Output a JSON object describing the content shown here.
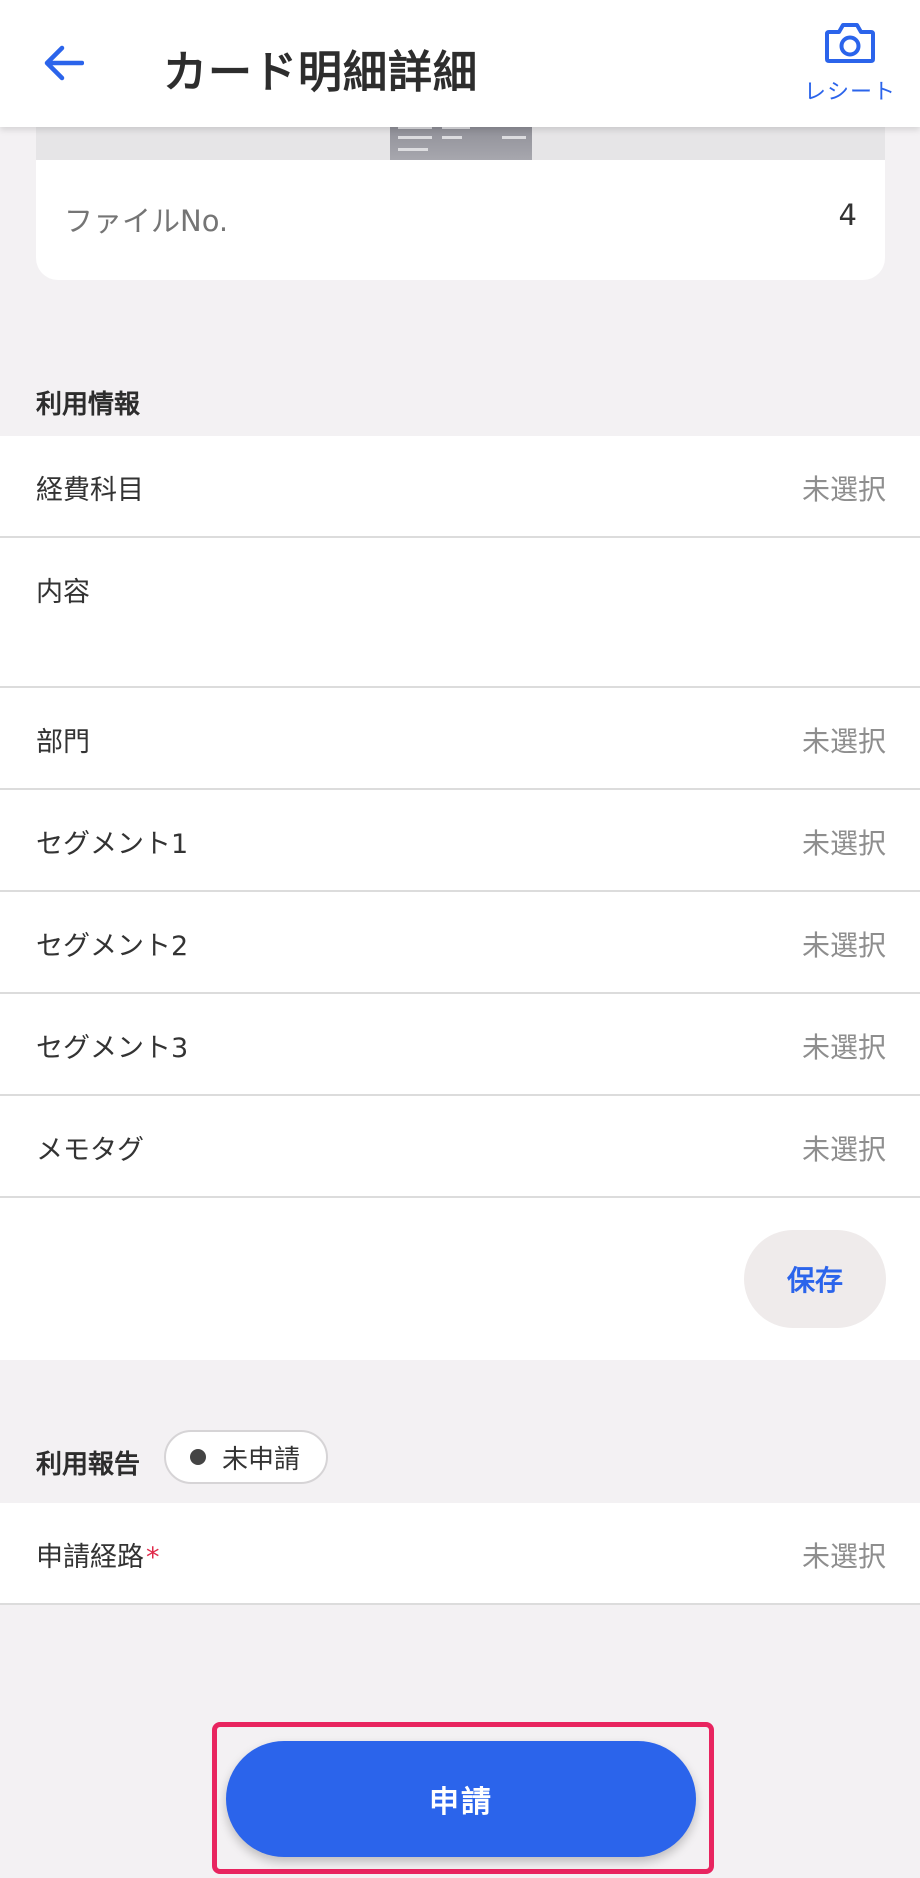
{
  "header": {
    "title": "カード明細詳細",
    "receipt_label": "レシート",
    "back_icon": "arrow-left-icon",
    "camera_icon": "camera-icon"
  },
  "file": {
    "label": "ファイルNo.",
    "value": "4"
  },
  "usage_info": {
    "title": "利用情報",
    "fields": [
      {
        "label": "経費科目",
        "value": "未選択"
      },
      {
        "label": "内容",
        "value": ""
      },
      {
        "label": "部門",
        "value": "未選択"
      },
      {
        "label": "セグメント1",
        "value": "未選択"
      },
      {
        "label": "セグメント2",
        "value": "未選択"
      },
      {
        "label": "セグメント3",
        "value": "未選択"
      },
      {
        "label": "メモタグ",
        "value": "未選択"
      }
    ],
    "save_label": "保存"
  },
  "usage_report": {
    "title": "利用報告",
    "status": "未申請",
    "route_label": "申請経路",
    "route_required": "*",
    "route_value": "未選択"
  },
  "apply_label": "申請",
  "colors": {
    "accent": "#2b64eb",
    "highlight": "#e8245f",
    "required": "#e02a4a",
    "background": "#f3f1f3"
  }
}
